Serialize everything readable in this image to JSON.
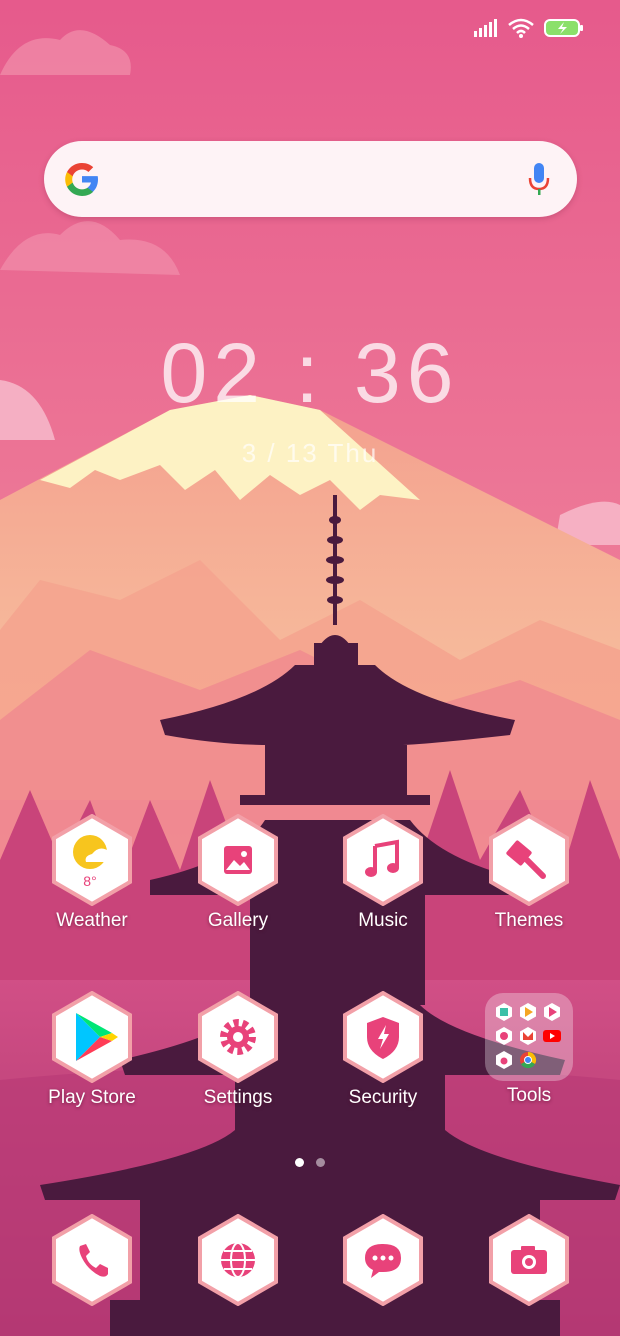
{
  "colors": {
    "sky": "#e85d8e",
    "accent": "#e8427a",
    "hex_border": "#f2a0a8",
    "pagoda": "#4a1a3e",
    "snow": "#fdf2c4"
  },
  "status_bar": {
    "icons": [
      "signal-icon",
      "wifi-icon",
      "battery-charging-icon"
    ]
  },
  "search": {
    "logo": "google-logo",
    "mic": "mic-icon"
  },
  "clock": {
    "time": "02 : 36",
    "date": "3 / 13   Thu"
  },
  "apps": {
    "weather": {
      "label": "Weather",
      "temp": "8°",
      "icon": "weather-icon"
    },
    "gallery": {
      "label": "Gallery",
      "icon": "gallery-icon"
    },
    "music": {
      "label": "Music",
      "icon": "music-icon"
    },
    "themes": {
      "label": "Themes",
      "icon": "brush-icon"
    },
    "playstore": {
      "label": "Play Store",
      "icon": "play-store-icon"
    },
    "settings": {
      "label": "Settings",
      "icon": "gear-icon"
    },
    "security": {
      "label": "Security",
      "icon": "shield-icon"
    },
    "tools": {
      "label": "Tools",
      "icon": "folder-icon"
    }
  },
  "dock": [
    {
      "icon": "phone-icon"
    },
    {
      "icon": "browser-icon"
    },
    {
      "icon": "messages-icon"
    },
    {
      "icon": "camera-icon"
    }
  ],
  "pager": {
    "pages": 2,
    "current": 1
  }
}
